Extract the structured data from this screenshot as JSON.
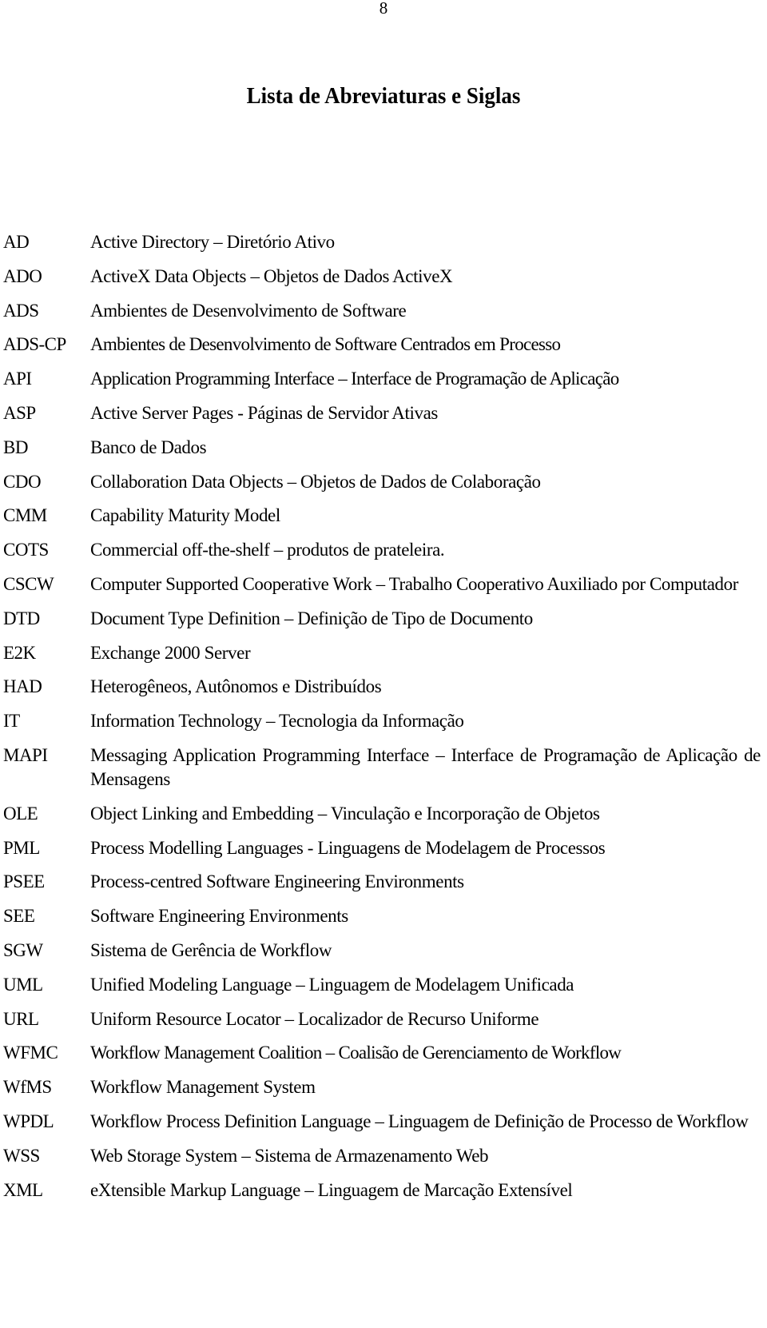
{
  "page": {
    "number": "8",
    "title": "Lista de Abreviaturas e Siglas"
  },
  "abbreviations": [
    {
      "term": "AD",
      "definition": "Active Directory – Diretório Ativo"
    },
    {
      "term": "ADO",
      "definition": "ActiveX Data Objects – Objetos de Dados ActiveX"
    },
    {
      "term": "ADS",
      "definition": "Ambientes de Desenvolvimento de Software"
    },
    {
      "term": "ADS-CP",
      "definition": "Ambientes de Desenvolvimento de Software Centrados em Processo"
    },
    {
      "term": "API",
      "definition": "Application Programming Interface – Interface de Programação de Aplicação"
    },
    {
      "term": "ASP",
      "definition": "Active Server Pages - Páginas de Servidor Ativas"
    },
    {
      "term": "BD",
      "definition": "Banco de Dados"
    },
    {
      "term": "CDO",
      "definition": "Collaboration Data Objects – Objetos de Dados de Colaboração"
    },
    {
      "term": "CMM",
      "definition": "Capability Maturity Model"
    },
    {
      "term": "COTS",
      "definition": "Commercial off-the-shelf – produtos de prateleira."
    },
    {
      "term": "CSCW",
      "definition": "Computer Supported Cooperative Work – Trabalho Cooperativo Auxiliado por Computador"
    },
    {
      "term": "DTD",
      "definition": "Document Type Definition – Definição de Tipo de Documento"
    },
    {
      "term": "E2K",
      "definition": "Exchange 2000 Server"
    },
    {
      "term": "HAD",
      "definition": "Heterogêneos, Autônomos e Distribuídos"
    },
    {
      "term": "IT",
      "definition": "Information Technology – Tecnologia da Informação"
    },
    {
      "term": "MAPI",
      "definition": "Messaging Application Programming Interface – Interface de Programação de Aplicação de Mensagens"
    },
    {
      "term": "OLE",
      "definition": "Object Linking and Embedding – Vinculação e Incorporação de Objetos"
    },
    {
      "term": "PML",
      "definition": "Process Modelling Languages - Linguagens de Modelagem de Processos"
    },
    {
      "term": "PSEE",
      "definition": "Process-centred Software Engineering Environments"
    },
    {
      "term": "SEE",
      "definition": "Software Engineering Environments"
    },
    {
      "term": "SGW",
      "definition": "Sistema de Gerência de Workflow"
    },
    {
      "term": "UML",
      "definition": "Unified Modeling Language – Linguagem de Modelagem Unificada"
    },
    {
      "term": "URL",
      "definition": "Uniform Resource Locator – Localizador de Recurso Uniforme"
    },
    {
      "term": "WFMC",
      "definition": "Workflow Management Coalition – Coalisão de Gerenciamento de Workflow"
    },
    {
      "term": "WfMS",
      "definition": "Workflow Management System"
    },
    {
      "term": "WPDL",
      "definition": "Workflow Process Definition Language – Linguagem de Definição de Processo de Workflow"
    },
    {
      "term": "WSS",
      "definition": "Web Storage System – Sistema de Armazenamento Web"
    },
    {
      "term": "XML",
      "definition": "eXtensible Markup Language – Linguagem de Marcação Extensível"
    }
  ]
}
